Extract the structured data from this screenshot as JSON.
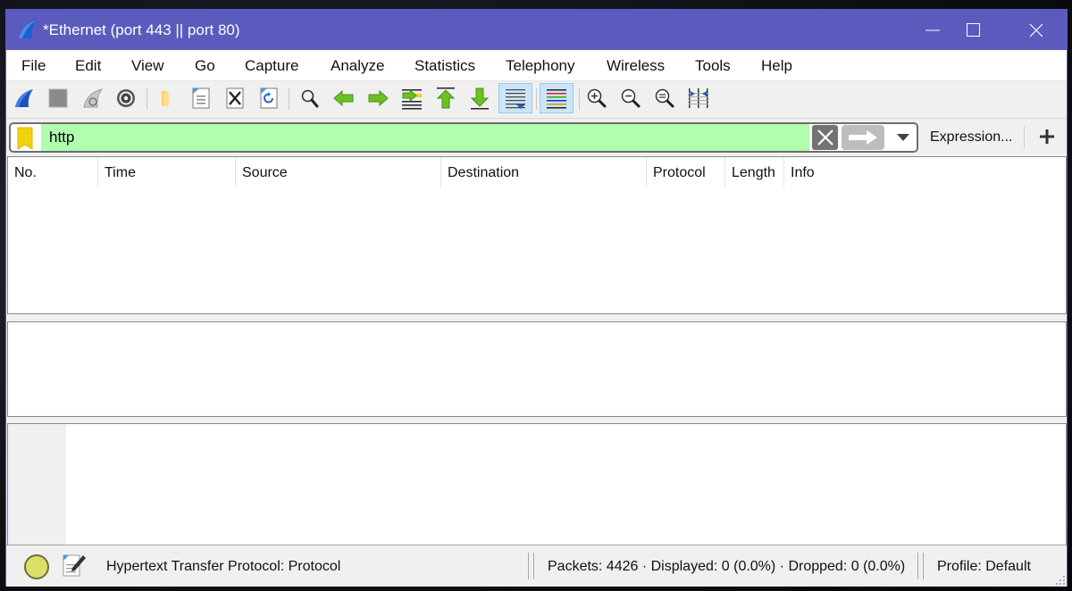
{
  "window": {
    "title": "*Ethernet (port 443 || port 80)",
    "controls": {
      "minimize": "minimize-icon",
      "maximize": "maximize-icon",
      "close": "close-icon"
    }
  },
  "menu": {
    "items": [
      "File",
      "Edit",
      "View",
      "Go",
      "Capture",
      "Analyze",
      "Statistics",
      "Telephony",
      "Wireless",
      "Tools",
      "Help"
    ]
  },
  "toolbar": {
    "buttons": [
      {
        "name": "start-capture",
        "icon": "shark-fin-icon"
      },
      {
        "name": "stop-capture",
        "icon": "stop-square-icon"
      },
      {
        "name": "restart-capture",
        "icon": "restart-fin-icon"
      },
      {
        "name": "capture-options",
        "icon": "gear-icon"
      },
      {
        "name": "open-file",
        "icon": "folder-icon"
      },
      {
        "name": "save-file",
        "icon": "file-binary-icon"
      },
      {
        "name": "close-file",
        "icon": "file-close-icon"
      },
      {
        "name": "reload-file",
        "icon": "file-reload-icon"
      },
      {
        "name": "find-packet",
        "icon": "magnifier-icon"
      },
      {
        "name": "go-back",
        "icon": "arrow-left-icon"
      },
      {
        "name": "go-forward",
        "icon": "arrow-right-icon"
      },
      {
        "name": "go-to-packet",
        "icon": "jump-to-icon"
      },
      {
        "name": "go-first",
        "icon": "arrow-up-top-icon"
      },
      {
        "name": "go-last",
        "icon": "arrow-down-bottom-icon"
      },
      {
        "name": "autoscroll",
        "icon": "autoscroll-icon",
        "active": true
      },
      {
        "name": "colorize",
        "icon": "colorize-lines-icon",
        "active": true
      },
      {
        "name": "zoom-in",
        "icon": "zoom-in-icon"
      },
      {
        "name": "zoom-out",
        "icon": "zoom-out-icon"
      },
      {
        "name": "normal-size",
        "icon": "zoom-reset-icon"
      },
      {
        "name": "resize-columns",
        "icon": "resize-columns-icon"
      }
    ]
  },
  "filter": {
    "value": "http",
    "placeholder": "Apply a display filter …",
    "valid_color": "#afffaf",
    "expression_label": "Expression...",
    "add_label": "+"
  },
  "packet_list": {
    "columns": [
      "No.",
      "Time",
      "Source",
      "Destination",
      "Protocol",
      "Length",
      "Info"
    ],
    "rows": []
  },
  "status": {
    "field_info": "Hypertext Transfer Protocol: Protocol",
    "packets": "Packets: 4426 · Displayed: 0 (0.0%) · Dropped: 0 (0.0%)",
    "profile": "Profile: Default"
  },
  "colors": {
    "titlebar": "#5a5bbd",
    "filter_valid": "#afffaf",
    "status_led": "#dede6b"
  }
}
